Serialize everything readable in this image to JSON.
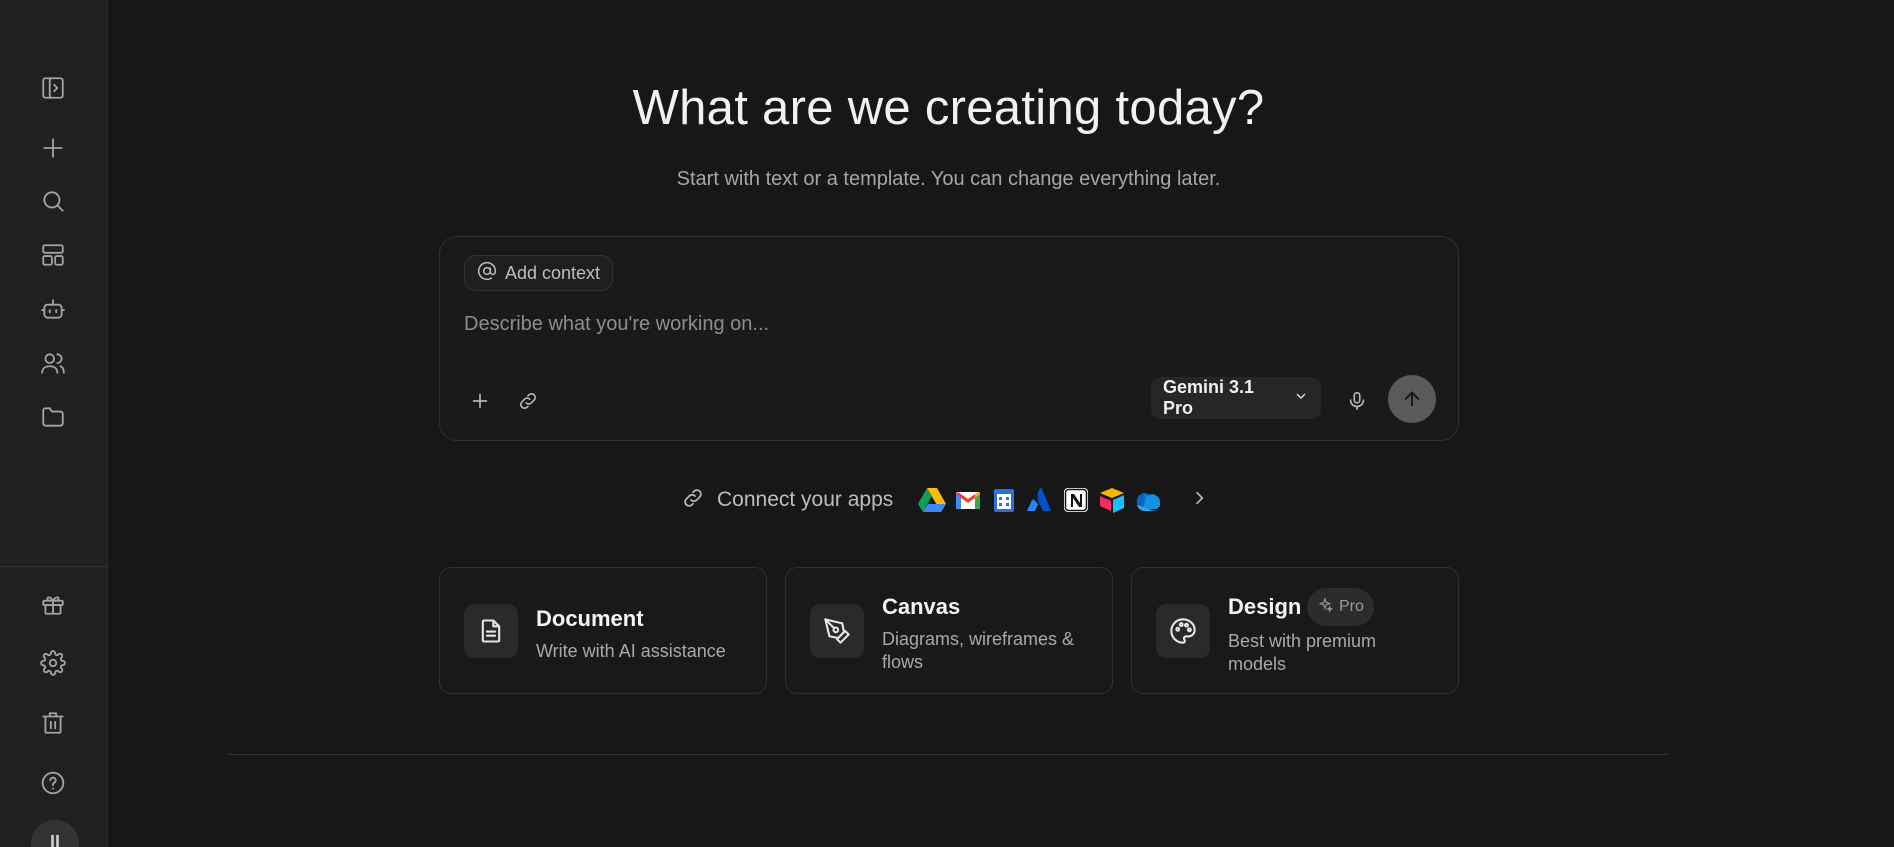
{
  "sidebar": {
    "top_icons": [
      {
        "name": "toggle-sidebar-icon"
      },
      {
        "name": "plus-icon"
      },
      {
        "name": "search-icon"
      },
      {
        "name": "templates-icon"
      },
      {
        "name": "bot-icon"
      },
      {
        "name": "users-icon"
      },
      {
        "name": "folder-icon"
      }
    ],
    "bottom_icons": [
      {
        "name": "gift-icon"
      },
      {
        "name": "gear-icon"
      },
      {
        "name": "trash-icon"
      },
      {
        "name": "help-icon"
      }
    ],
    "avatar_initial": "II"
  },
  "hero": {
    "title": "What are we creating today?",
    "subtitle": "Start with text or a template. You can change everything later."
  },
  "composer": {
    "context_chip": "Add context",
    "placeholder": "Describe what you're working on...",
    "value": "",
    "model": "Gemini 3.1 Pro"
  },
  "connect": {
    "label": "Connect your apps",
    "apps": [
      "google-drive-icon",
      "gmail-icon",
      "google-calendar-icon",
      "atlassian-icon",
      "notion-icon",
      "airtable-icon",
      "onedrive-icon"
    ]
  },
  "cards": [
    {
      "title": "Document",
      "desc": "Write with AI assistance",
      "icon": "document-icon"
    },
    {
      "title": "Canvas",
      "desc": "Diagrams, wireframes & flows",
      "icon": "pen-tool-icon"
    },
    {
      "title": "Design",
      "desc": "Best with premium models",
      "icon": "palette-icon",
      "badge": "Pro"
    }
  ],
  "colors": {
    "background": "#171717",
    "sidebar": "#202020",
    "send_button": "#5a5a5a"
  }
}
